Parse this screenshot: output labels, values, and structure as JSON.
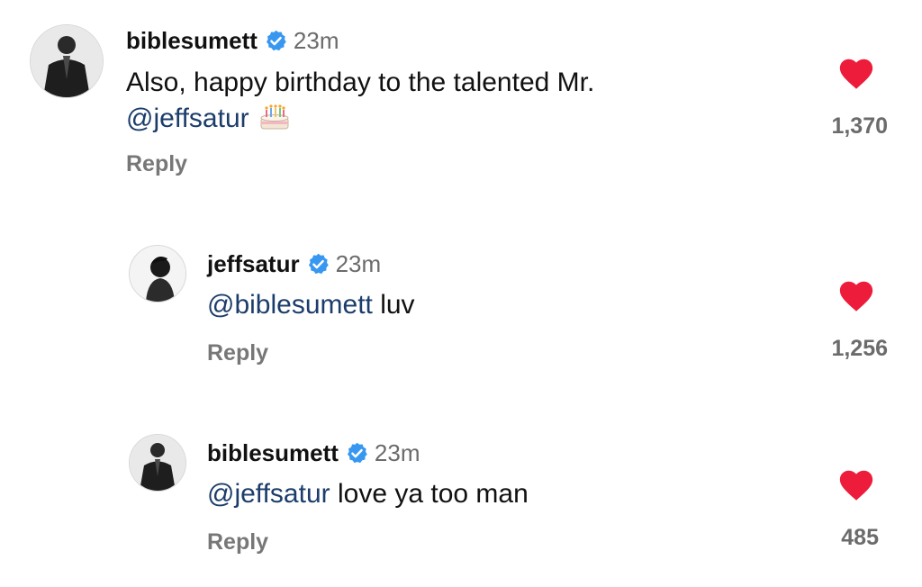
{
  "comments": [
    {
      "username": "biblesumett",
      "time": "23m",
      "line1": "Also, happy birthday to the talented Mr.",
      "mention": "@jeffsatur",
      "rest": "",
      "reply_label": "Reply",
      "likes": "1,370"
    },
    {
      "username": "jeffsatur",
      "time": "23m",
      "mention": "@biblesumett",
      "rest": " luv",
      "reply_label": "Reply",
      "likes": "1,256"
    },
    {
      "username": "biblesumett",
      "time": "23m",
      "mention": "@jeffsatur",
      "rest": " love ya too man",
      "reply_label": "Reply",
      "likes": "485"
    }
  ],
  "colors": {
    "heart": "#ed1c3a",
    "verified": "#3897f0",
    "mention": "#1c3d6b",
    "muted": "#6b6b6b"
  },
  "icons": [
    "verified-badge-icon",
    "birthday-cake-icon",
    "heart-icon"
  ]
}
